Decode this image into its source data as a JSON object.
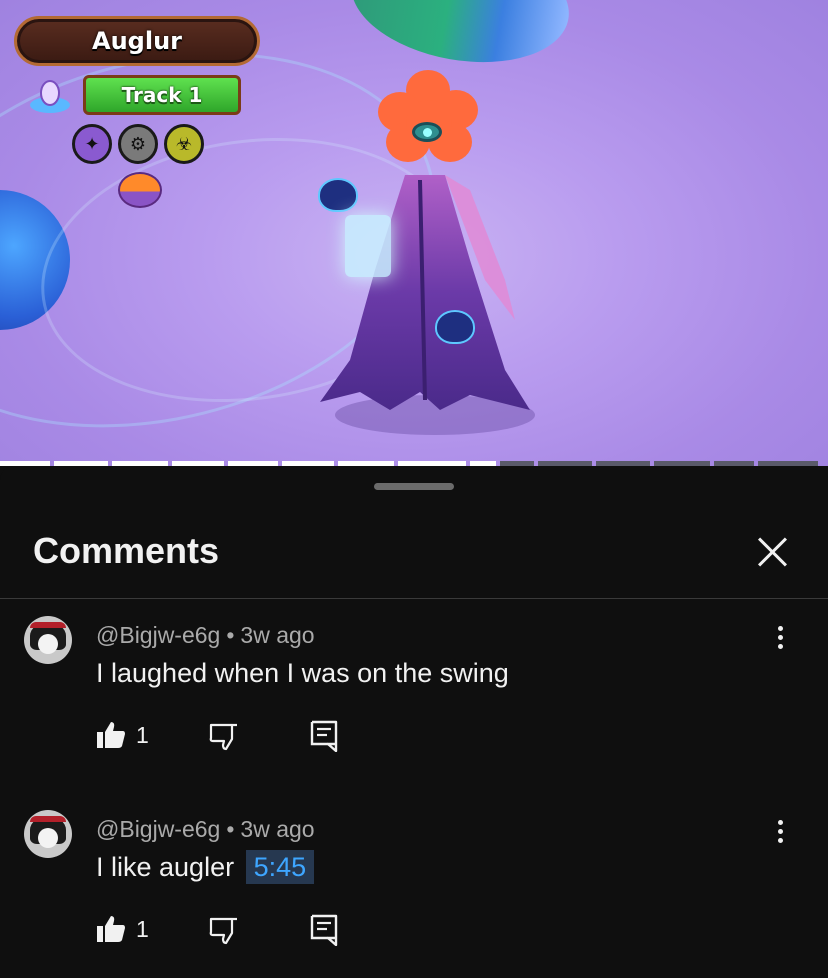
{
  "video": {
    "monster_name": "Auglur",
    "track_label": "Track 1",
    "progress_fraction": 0.63
  },
  "comments_sheet": {
    "title": "Comments",
    "comments": [
      {
        "author": "@Bigjw-e6g",
        "separator": "•",
        "time": "3w ago",
        "text": "I laughed when I was on the swing",
        "timestamp_link": "",
        "likes": "1"
      },
      {
        "author": "@Bigjw-e6g",
        "separator": "•",
        "time": "3w ago",
        "text": "I like augler",
        "timestamp_link": "5:45",
        "likes": "1"
      }
    ]
  },
  "icons": {
    "close": "close-icon",
    "more": "more-vert-icon",
    "like": "thumb-up-icon",
    "dislike": "thumb-down-icon",
    "reply": "reply-icon"
  }
}
